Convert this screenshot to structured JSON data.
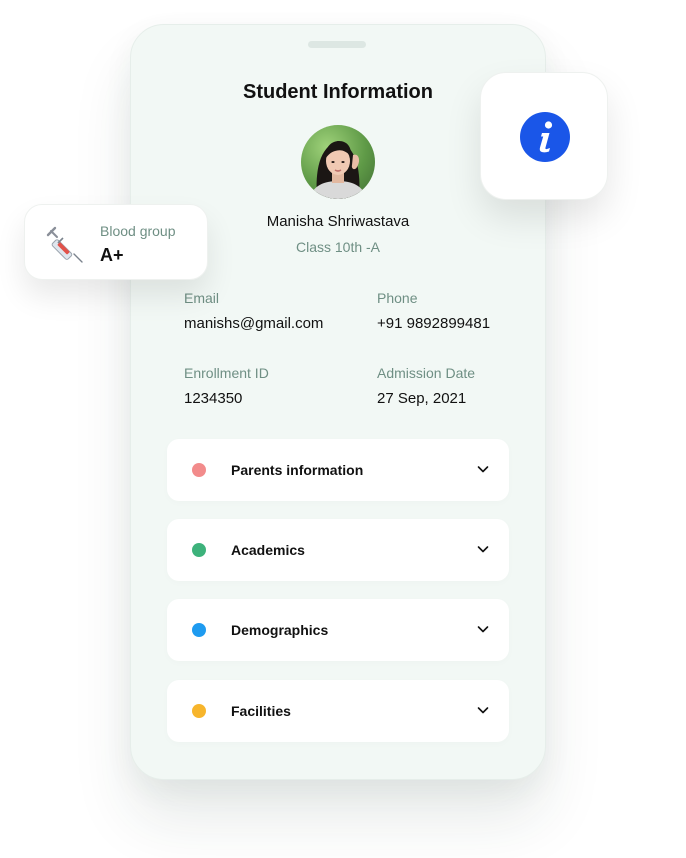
{
  "profile": {
    "title": "Student Information",
    "name": "Manisha Shriwastava",
    "class_label": "Class 10th -A"
  },
  "details": {
    "email_label": "Email",
    "email_value": "manishs@gmail.com",
    "phone_label": "Phone",
    "phone_value": "+91 9892899481",
    "enrollment_label": "Enrollment ID",
    "enrollment_value": "1234350",
    "admission_label": "Admission Date",
    "admission_value": "27 Sep, 2021"
  },
  "sections": [
    {
      "label": "Parents information",
      "color": "#f28b8b"
    },
    {
      "label": "Academics",
      "color": "#3db27b"
    },
    {
      "label": "Demographics",
      "color": "#1e9bf0"
    },
    {
      "label": "Facilities",
      "color": "#f7b52c"
    }
  ],
  "blood_card": {
    "label": "Blood group",
    "value": "A+",
    "icon": "syringe-icon"
  },
  "info_card": {
    "icon": "info-icon",
    "color": "#1a56e8"
  }
}
